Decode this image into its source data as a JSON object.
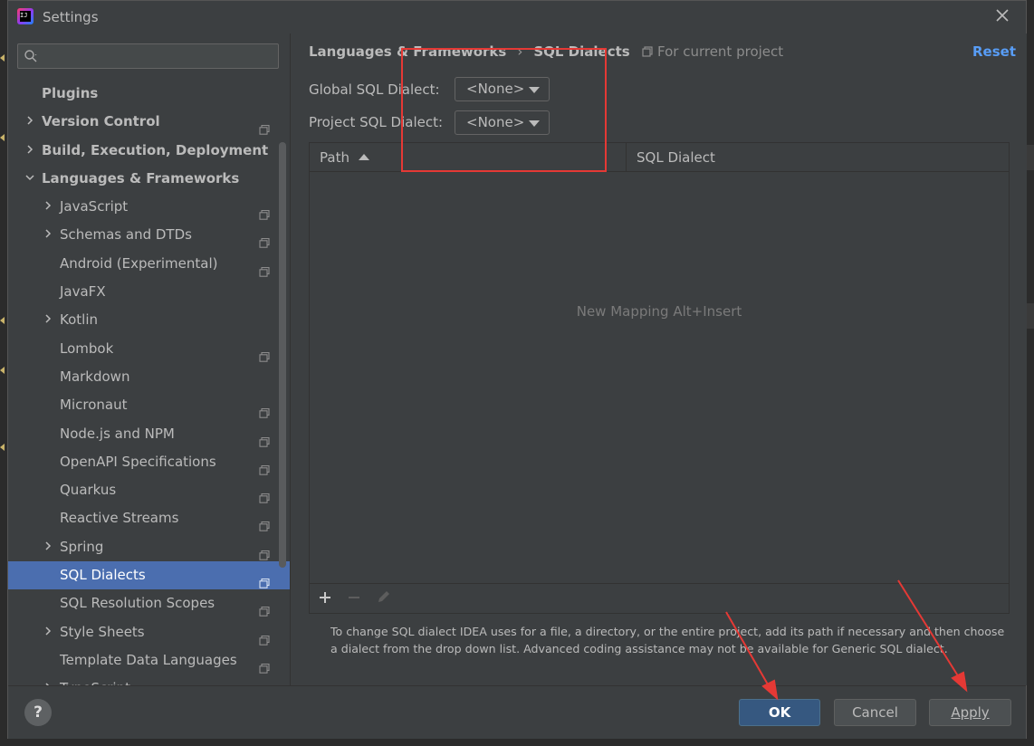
{
  "window": {
    "title": "Settings"
  },
  "search": {
    "placeholder": ""
  },
  "sidebar": {
    "items": [
      {
        "label": "Plugins",
        "level": 0,
        "bold": true,
        "chevron": false,
        "project_icon": false
      },
      {
        "label": "Version Control",
        "level": 0,
        "bold": true,
        "chevron": true,
        "project_icon": true
      },
      {
        "label": "Build, Execution, Deployment",
        "level": 0,
        "bold": true,
        "chevron": true,
        "project_icon": false
      },
      {
        "label": "Languages & Frameworks",
        "level": 0,
        "bold": true,
        "chevron": true,
        "expanded": true,
        "project_icon": false
      },
      {
        "label": "JavaScript",
        "level": 1,
        "chevron": true,
        "project_icon": true
      },
      {
        "label": "Schemas and DTDs",
        "level": 1,
        "chevron": true,
        "project_icon": true
      },
      {
        "label": "Android (Experimental)",
        "level": 1,
        "chevron": false,
        "project_icon": true
      },
      {
        "label": "JavaFX",
        "level": 1,
        "chevron": false,
        "project_icon": false
      },
      {
        "label": "Kotlin",
        "level": 1,
        "chevron": true,
        "project_icon": false
      },
      {
        "label": "Lombok",
        "level": 1,
        "chevron": false,
        "project_icon": true
      },
      {
        "label": "Markdown",
        "level": 1,
        "chevron": false,
        "project_icon": false
      },
      {
        "label": "Micronaut",
        "level": 1,
        "chevron": false,
        "project_icon": true
      },
      {
        "label": "Node.js and NPM",
        "level": 1,
        "chevron": false,
        "project_icon": true
      },
      {
        "label": "OpenAPI Specifications",
        "level": 1,
        "chevron": false,
        "project_icon": true
      },
      {
        "label": "Quarkus",
        "level": 1,
        "chevron": false,
        "project_icon": true
      },
      {
        "label": "Reactive Streams",
        "level": 1,
        "chevron": false,
        "project_icon": true
      },
      {
        "label": "Spring",
        "level": 1,
        "chevron": true,
        "project_icon": true
      },
      {
        "label": "SQL Dialects",
        "level": 1,
        "chevron": false,
        "project_icon": true,
        "selected": true
      },
      {
        "label": "SQL Resolution Scopes",
        "level": 1,
        "chevron": false,
        "project_icon": true
      },
      {
        "label": "Style Sheets",
        "level": 1,
        "chevron": true,
        "project_icon": true
      },
      {
        "label": "Template Data Languages",
        "level": 1,
        "chevron": false,
        "project_icon": true
      },
      {
        "label": "TypeScript",
        "level": 1,
        "chevron": true,
        "project_icon": true
      }
    ]
  },
  "main": {
    "breadcrumb": {
      "parent": "Languages & Frameworks",
      "separator": "›",
      "current": "SQL Dialects"
    },
    "scope_text": "For current project",
    "reset_label": "Reset",
    "global_label": "Global SQL Dialect:",
    "global_value": "<None>",
    "project_label": "Project SQL Dialect:",
    "project_value": "<None>",
    "table": {
      "columns": [
        "Path",
        "SQL Dialect"
      ],
      "empty_text": "New Mapping",
      "empty_shortcut": "Alt+Insert"
    },
    "hint": "To change SQL dialect IDEA uses for a file, a directory, or the entire project, add its path if necessary and then choose a dialect from the drop down list. Advanced coding assistance may not be available for Generic SQL dialect."
  },
  "footer": {
    "help_label": "?",
    "ok_label": "OK",
    "cancel_label": "Cancel",
    "apply_label": "Apply"
  },
  "colors": {
    "background": "#3c3f41",
    "selection": "#4b6eaf",
    "link": "#589df6",
    "default_button": "#365880",
    "annotation": "#e53935"
  }
}
